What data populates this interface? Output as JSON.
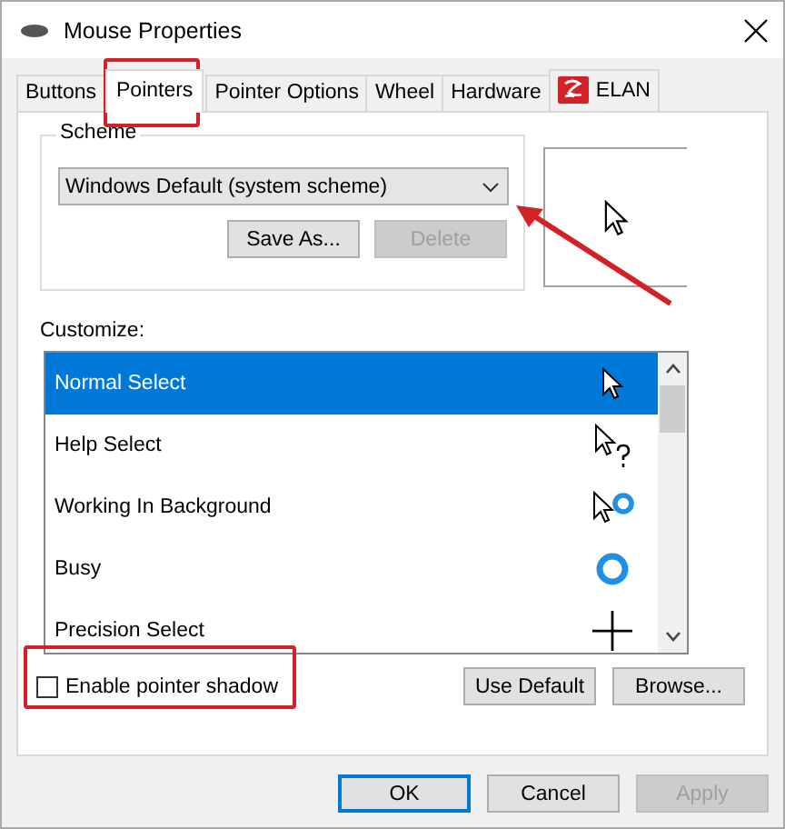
{
  "window": {
    "title": "Mouse Properties"
  },
  "tabs": [
    {
      "label": "Buttons",
      "selected": false
    },
    {
      "label": "Pointers",
      "selected": true
    },
    {
      "label": "Pointer Options",
      "selected": false
    },
    {
      "label": "Wheel",
      "selected": false
    },
    {
      "label": "Hardware",
      "selected": false
    },
    {
      "label": "ELAN",
      "selected": false,
      "kind": "logo"
    }
  ],
  "scheme": {
    "legend": "Scheme",
    "value": "Windows Default (system scheme)",
    "buttons": [
      {
        "label": "Save As...",
        "disabled": false
      },
      {
        "label": "Delete",
        "disabled": true
      }
    ]
  },
  "customize": {
    "label": "Customize:",
    "items": [
      {
        "label": "Normal Select",
        "selected": true,
        "kind": "arrow"
      },
      {
        "label": "Help Select",
        "selected": false,
        "kind": "help"
      },
      {
        "label": "Working In Background",
        "selected": false,
        "kind": "working"
      },
      {
        "label": "Busy",
        "selected": false,
        "kind": "busy"
      },
      {
        "label": "Precision Select",
        "selected": false,
        "kind": "precision"
      }
    ]
  },
  "shadow": {
    "label": "Enable pointer shadow",
    "checked": false
  },
  "list_buttons": [
    {
      "label": "Use Default",
      "disabled": false
    },
    {
      "label": "Browse...",
      "disabled": false
    }
  ],
  "dialog_buttons": [
    {
      "label": "OK",
      "disabled": false,
      "default": true
    },
    {
      "label": "Cancel",
      "disabled": false,
      "default": false
    },
    {
      "label": "Apply",
      "disabled": true,
      "default": false
    }
  ]
}
